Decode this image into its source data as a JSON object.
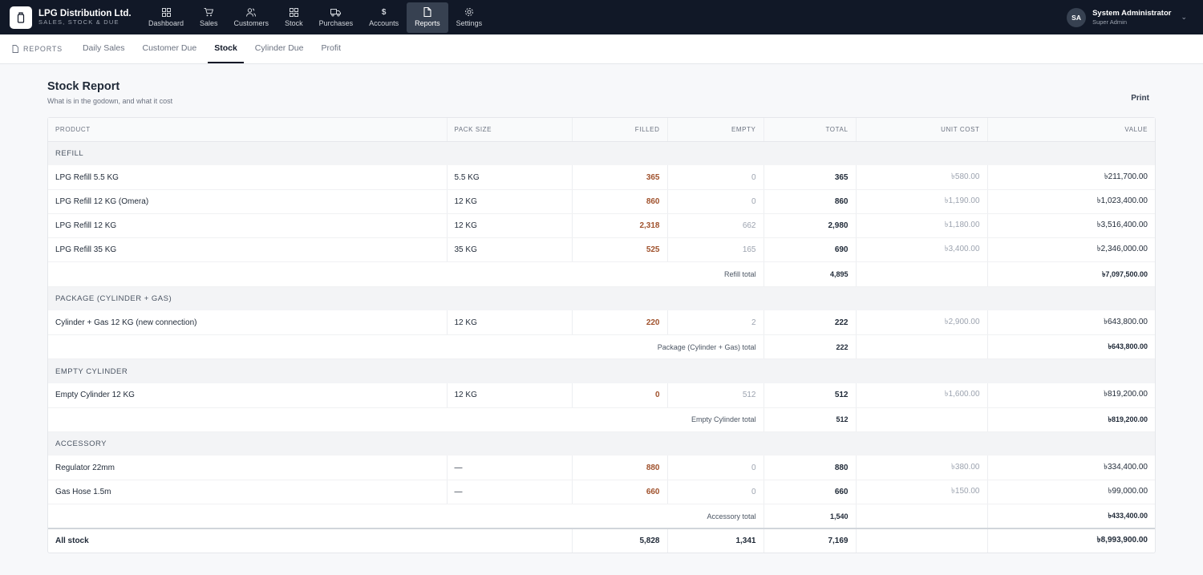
{
  "brand": {
    "name": "LPG Distribution Ltd.",
    "subtitle": "SALES, STOCK & DUE"
  },
  "nav": [
    {
      "label": "Dashboard",
      "icon": "grid-icon"
    },
    {
      "label": "Sales",
      "icon": "cart-icon"
    },
    {
      "label": "Customers",
      "icon": "users-icon"
    },
    {
      "label": "Stock",
      "icon": "grid-icon"
    },
    {
      "label": "Purchases",
      "icon": "truck-icon"
    },
    {
      "label": "Accounts",
      "icon": "dollar-icon"
    },
    {
      "label": "Reports",
      "icon": "document-icon",
      "active": true
    },
    {
      "label": "Settings",
      "icon": "gear-icon"
    }
  ],
  "user": {
    "initials": "SA",
    "name": "System Administrator",
    "role": "Super Admin"
  },
  "subnav": {
    "root": "REPORTS",
    "tabs": [
      "Daily Sales",
      "Customer Due",
      "Stock",
      "Cylinder Due",
      "Profit"
    ],
    "active": "Stock"
  },
  "page": {
    "title": "Stock Report",
    "subtitle": "What is in the godown, and what it cost",
    "print": "Print"
  },
  "table": {
    "headers": [
      "PRODUCT",
      "PACK SIZE",
      "FILLED",
      "EMPTY",
      "TOTAL",
      "UNIT COST",
      "VALUE"
    ],
    "groups": [
      {
        "name": "REFILL",
        "rows": [
          [
            "LPG Refill 5.5 KG",
            "5.5 KG",
            "365",
            "0",
            "365",
            "৳580.00",
            "৳211,700.00"
          ],
          [
            "LPG Refill 12 KG (Omera)",
            "12 KG",
            "860",
            "0",
            "860",
            "৳1,190.00",
            "৳1,023,400.00"
          ],
          [
            "LPG Refill 12 KG",
            "12 KG",
            "2,318",
            "662",
            "2,980",
            "৳1,180.00",
            "৳3,516,400.00"
          ],
          [
            "LPG Refill 35 KG",
            "35 KG",
            "525",
            "165",
            "690",
            "৳3,400.00",
            "৳2,346,000.00"
          ]
        ],
        "total_label": "Refill total",
        "total_qty": "4,895",
        "total_value": "৳7,097,500.00"
      },
      {
        "name": "PACKAGE (CYLINDER + GAS)",
        "rows": [
          [
            "Cylinder + Gas 12 KG (new connection)",
            "12 KG",
            "220",
            "2",
            "222",
            "৳2,900.00",
            "৳643,800.00"
          ]
        ],
        "total_label": "Package (Cylinder + Gas) total",
        "total_qty": "222",
        "total_value": "৳643,800.00"
      },
      {
        "name": "EMPTY CYLINDER",
        "rows": [
          [
            "Empty Cylinder 12 KG",
            "12 KG",
            "0",
            "512",
            "512",
            "৳1,600.00",
            "৳819,200.00"
          ]
        ],
        "total_label": "Empty Cylinder total",
        "total_qty": "512",
        "total_value": "৳819,200.00"
      },
      {
        "name": "ACCESSORY",
        "rows": [
          [
            "Regulator 22mm",
            "—",
            "880",
            "0",
            "880",
            "৳380.00",
            "৳334,400.00"
          ],
          [
            "Gas Hose 1.5m",
            "—",
            "660",
            "0",
            "660",
            "৳150.00",
            "৳99,000.00"
          ]
        ],
        "total_label": "Accessory total",
        "total_qty": "1,540",
        "total_value": "৳433,400.00"
      }
    ],
    "grand": {
      "label": "All stock",
      "filled": "5,828",
      "empty": "1,341",
      "total": "7,169",
      "value": "৳8,993,900.00"
    }
  }
}
